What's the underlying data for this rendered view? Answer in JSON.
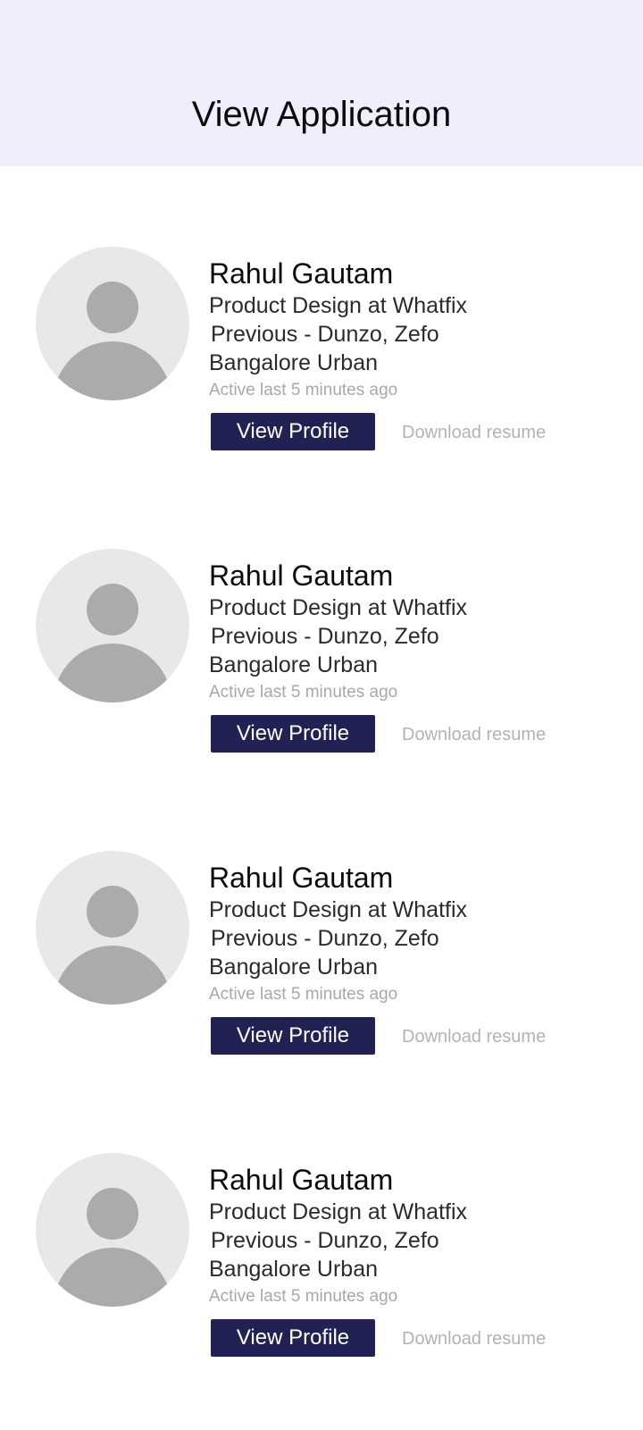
{
  "header": {
    "title": "View Application"
  },
  "applicants": [
    {
      "name": "Rahul Gautam",
      "role": "Product Design at Whatfix",
      "previous": "Previous - Dunzo, Zefo",
      "location": "Bangalore Urban",
      "activity": "Active last 5 minutes ago",
      "view_profile_label": "View Profile",
      "download_label": "Download resume",
      "avatar_icon": "person-placeholder-icon"
    },
    {
      "name": "Rahul Gautam",
      "role": "Product Design at Whatfix",
      "previous": "Previous - Dunzo, Zefo",
      "location": "Bangalore Urban",
      "activity": "Active last 5 minutes ago",
      "view_profile_label": "View Profile",
      "download_label": "Download resume",
      "avatar_icon": "person-placeholder-icon"
    },
    {
      "name": "Rahul Gautam",
      "role": "Product Design at Whatfix",
      "previous": "Previous - Dunzo, Zefo",
      "location": "Bangalore Urban",
      "activity": "Active last 5 minutes ago",
      "view_profile_label": "View Profile",
      "download_label": "Download resume",
      "avatar_icon": "person-placeholder-icon"
    },
    {
      "name": "Rahul Gautam",
      "role": "Product Design at Whatfix",
      "previous": "Previous - Dunzo, Zefo",
      "location": "Bangalore Urban",
      "activity": "Active last 5 minutes ago",
      "view_profile_label": "View Profile",
      "download_label": "Download resume",
      "avatar_icon": "person-placeholder-icon"
    }
  ],
  "colors": {
    "header_bg": "#eeeefc",
    "button_bg": "#222154",
    "button_text": "#ffffff",
    "muted_text": "#b3b3b3",
    "avatar_bg": "#e8e8e8",
    "avatar_fg": "#ababab"
  }
}
